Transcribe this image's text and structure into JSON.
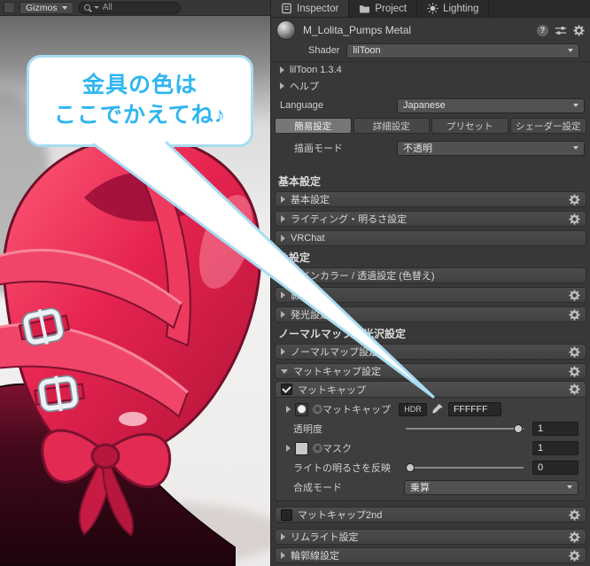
{
  "scene": {
    "toolbar": {
      "gizmos": "Gizmos",
      "search": "All"
    },
    "bubble": {
      "line1": "金具の色は",
      "line2": "ここでかえてね♪"
    }
  },
  "inspector": {
    "tabs": {
      "inspector": "Inspector",
      "project": "Project",
      "lighting": "Lighting"
    },
    "material": {
      "name": "M_Lolita_Pumps Metal",
      "shader_label": "Shader",
      "shader_value": "lilToon"
    },
    "foldouts": {
      "version": "lilToon 1.3.4",
      "help": "ヘルプ"
    },
    "language": {
      "label": "Language",
      "value": "Japanese"
    },
    "mode_tabs": {
      "simple": "簡易設定",
      "advanced": "詳細設定",
      "preset": "プリセット",
      "shader": "シェーダー設定"
    },
    "render_mode": {
      "label": "描画モード",
      "value": "不透明"
    },
    "headers": {
      "basic": "基本設定",
      "color": "色設定",
      "normal": "ノーマルマップ・光沢設定"
    },
    "bars": {
      "basic": "基本設定",
      "lighting": "ライティング・明るさ設定",
      "vrchat": "VRChat",
      "main_color": "メインカラー / 透過設定 (色替え)",
      "shadow": "影設定",
      "emission": "発光設定",
      "normal_map": "ノーマルマップ設定",
      "matcap": "マットキャップ設定",
      "matcap2nd": "マットキャップ2nd",
      "rim": "リムライト設定",
      "outline": "輪郭線設定"
    },
    "matcap": {
      "enable": "マットキャップ",
      "texture": "◎マットキャップ",
      "hdr": "HDR",
      "color": "FFFFFF",
      "opacity_label": "透明度",
      "opacity_value": "1",
      "mask_label": "◎マスク",
      "mask_value": "1",
      "light_label": "ライトの明るさを反映",
      "light_value": "0",
      "blend_label": "合成モード",
      "blend_value": "乗算"
    }
  },
  "colors": {
    "accent": "#2eb6f0",
    "bubble_border": "#a8dcf2",
    "shoe_red": "#e62450",
    "panel_bg": "#383838"
  }
}
